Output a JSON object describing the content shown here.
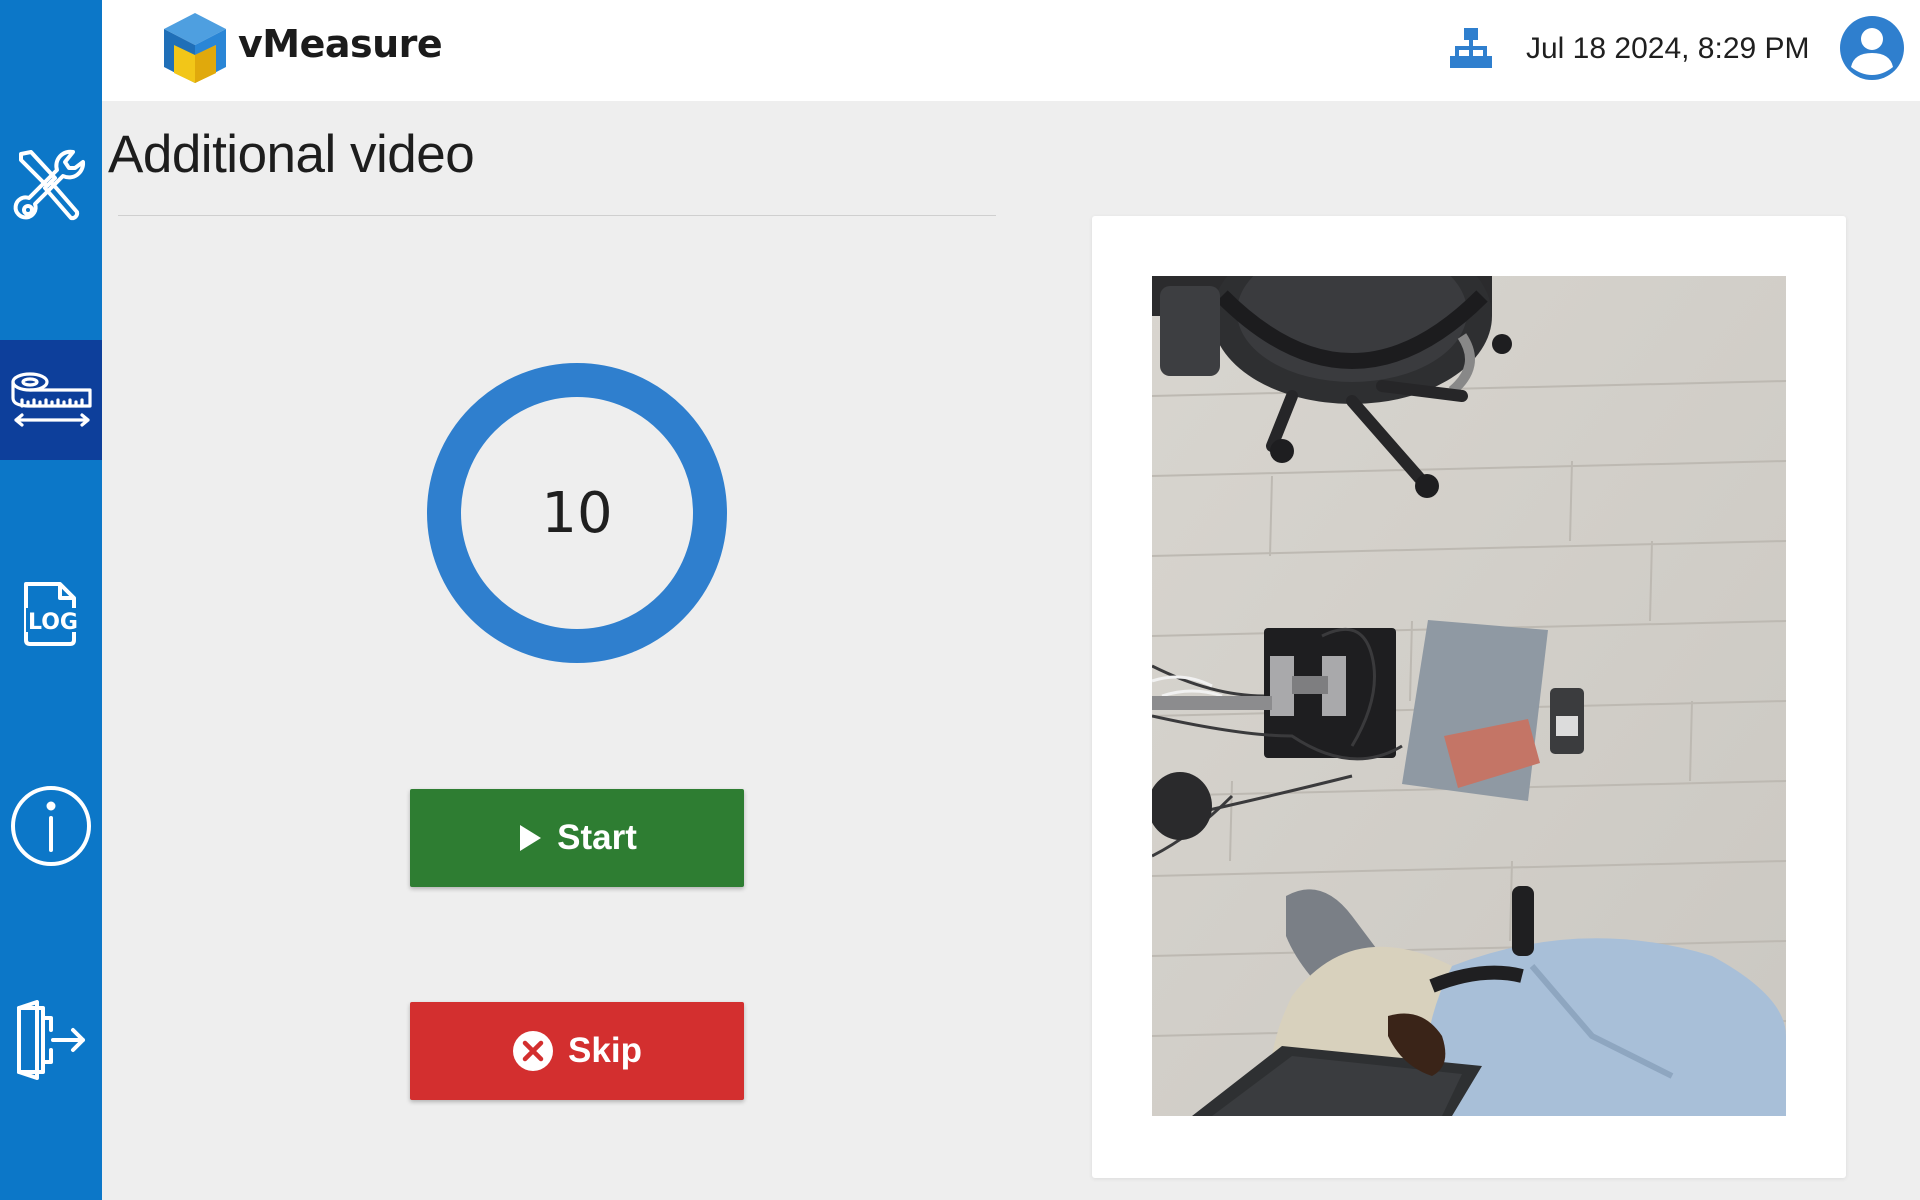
{
  "app": {
    "title": "vMeasure"
  },
  "header": {
    "datetime": "Jul 18 2024, 8:29 PM"
  },
  "sidebar": {
    "items": [
      {
        "id": "tools",
        "icon": "wrench-screwdriver-icon"
      },
      {
        "id": "measure",
        "icon": "tape-measure-icon",
        "active": true
      },
      {
        "id": "log",
        "icon": "log-file-icon",
        "label": "LOG"
      },
      {
        "id": "info",
        "icon": "info-icon"
      },
      {
        "id": "logout",
        "icon": "logout-icon"
      }
    ]
  },
  "page": {
    "title": "Additional video"
  },
  "countdown": {
    "value": "10"
  },
  "buttons": {
    "start_label": "Start",
    "skip_label": "Skip"
  },
  "colors": {
    "sidebar": "#0c77c8",
    "sidebar_active": "#0d3f9b",
    "accent": "#2f7fce",
    "start": "#2e7d32",
    "skip": "#d32f2f"
  }
}
